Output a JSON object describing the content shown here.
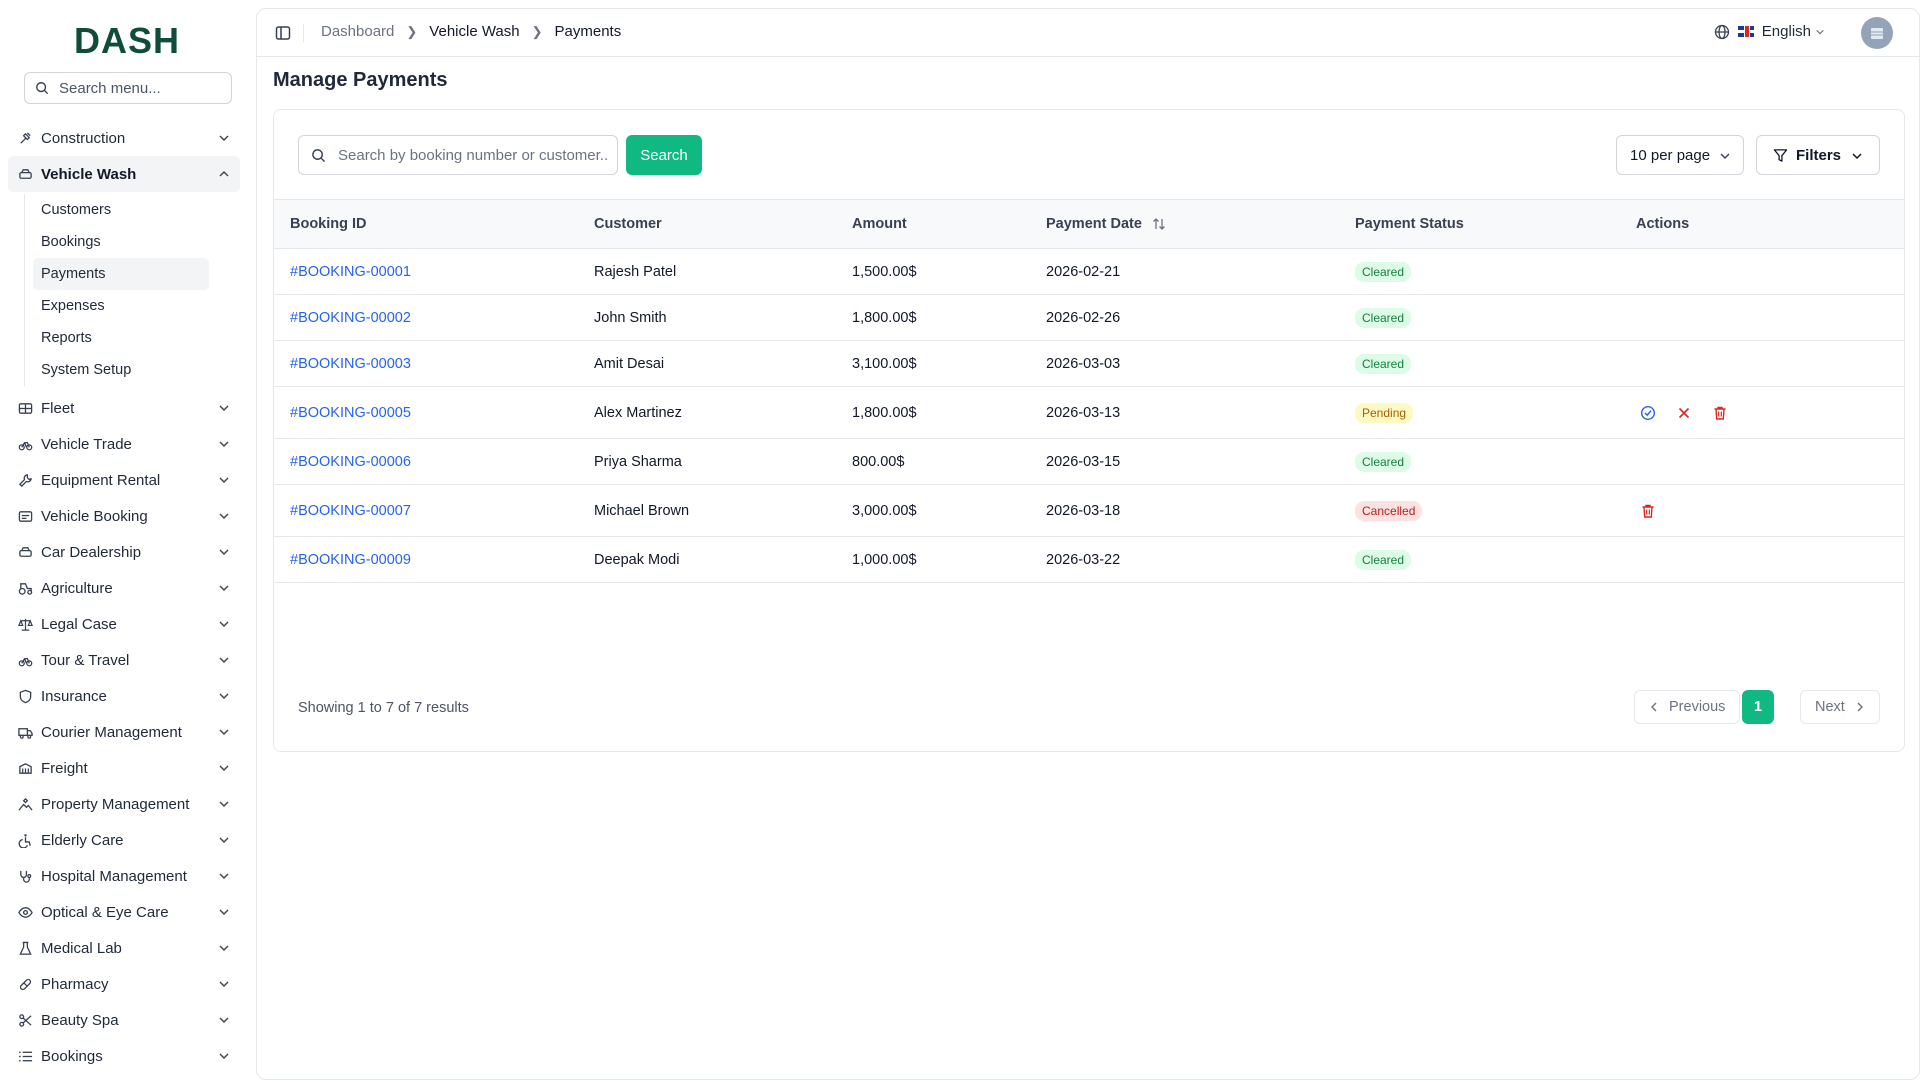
{
  "brand": {
    "logo_text": "DASH"
  },
  "sidebar": {
    "search_placeholder": "Search menu...",
    "items": [
      {
        "label": "Construction",
        "icon": "hammer-icon"
      },
      {
        "label": "Vehicle Wash",
        "icon": "car-icon",
        "open": true
      },
      {
        "label": "Fleet",
        "icon": "truck-grid-icon"
      },
      {
        "label": "Vehicle Trade",
        "icon": "bike-icon"
      },
      {
        "label": "Equipment Rental",
        "icon": "wrench-icon"
      },
      {
        "label": "Vehicle Booking",
        "icon": "booking-icon"
      },
      {
        "label": "Car Dealership",
        "icon": "car-icon"
      },
      {
        "label": "Agriculture",
        "icon": "tractor-icon"
      },
      {
        "label": "Legal Case",
        "icon": "scale-icon"
      },
      {
        "label": "Tour & Travel",
        "icon": "bike-icon"
      },
      {
        "label": "Insurance",
        "icon": "shield-icon"
      },
      {
        "label": "Courier Management",
        "icon": "truck-icon"
      },
      {
        "label": "Freight",
        "icon": "container-icon"
      },
      {
        "label": "Property Management",
        "icon": "building-icon"
      },
      {
        "label": "Elderly Care",
        "icon": "accessibility-icon"
      },
      {
        "label": "Hospital Management",
        "icon": "stethoscope-icon"
      },
      {
        "label": "Optical & Eye Care",
        "icon": "eye-icon"
      },
      {
        "label": "Medical Lab",
        "icon": "flask-icon"
      },
      {
        "label": "Pharmacy",
        "icon": "pill-icon"
      },
      {
        "label": "Beauty Spa",
        "icon": "scissors-icon"
      },
      {
        "label": "Bookings",
        "icon": "list-icon"
      }
    ],
    "subitems": [
      "Customers",
      "Bookings",
      "Payments",
      "Expenses",
      "Reports",
      "System Setup"
    ],
    "active_subitem": "Payments"
  },
  "breadcrumb": [
    "Dashboard",
    "Vehicle Wash",
    "Payments"
  ],
  "header": {
    "language": "English"
  },
  "page": {
    "title": "Manage Payments"
  },
  "toolbar": {
    "search_placeholder": "Search by booking number or customer...",
    "search_button": "Search",
    "per_page": "10 per page",
    "filters": "Filters"
  },
  "table": {
    "headers": [
      "Booking ID",
      "Customer",
      "Amount",
      "Payment Date",
      "Payment Status",
      "Actions"
    ],
    "rows": [
      {
        "id": "#BOOKING-00001",
        "customer": "Rajesh Patel",
        "amount": "1,500.00$",
        "date": "2026-02-21",
        "status": "Cleared",
        "actions": []
      },
      {
        "id": "#BOOKING-00002",
        "customer": "John Smith",
        "amount": "1,800.00$",
        "date": "2026-02-26",
        "status": "Cleared",
        "actions": []
      },
      {
        "id": "#BOOKING-00003",
        "customer": "Amit Desai",
        "amount": "3,100.00$",
        "date": "2026-03-03",
        "status": "Cleared",
        "actions": []
      },
      {
        "id": "#BOOKING-00005",
        "customer": "Alex Martinez",
        "amount": "1,800.00$",
        "date": "2026-03-13",
        "status": "Pending",
        "actions": [
          "approve-icon",
          "reject-icon",
          "delete-icon"
        ]
      },
      {
        "id": "#BOOKING-00006",
        "customer": "Priya Sharma",
        "amount": "800.00$",
        "date": "2026-03-15",
        "status": "Cleared",
        "actions": []
      },
      {
        "id": "#BOOKING-00007",
        "customer": "Michael Brown",
        "amount": "3,000.00$",
        "date": "2026-03-18",
        "status": "Cancelled",
        "actions": [
          "delete-icon"
        ]
      },
      {
        "id": "#BOOKING-00009",
        "customer": "Deepak Modi",
        "amount": "1,000.00$",
        "date": "2026-03-22",
        "status": "Cleared",
        "actions": []
      }
    ]
  },
  "status_colors": {
    "Cleared": {
      "bg": "#dcfce7",
      "fg": "#15803d"
    },
    "Pending": {
      "bg": "#fef9c3",
      "fg": "#a16207"
    },
    "Cancelled": {
      "bg": "#fee2e2",
      "fg": "#b91c1c"
    }
  },
  "pagination": {
    "info": "Showing 1 to 7 of 7 results",
    "previous": "Previous",
    "current": "1",
    "next": "Next"
  },
  "colors": {
    "accent": "#10b981",
    "link": "#2563eb"
  }
}
